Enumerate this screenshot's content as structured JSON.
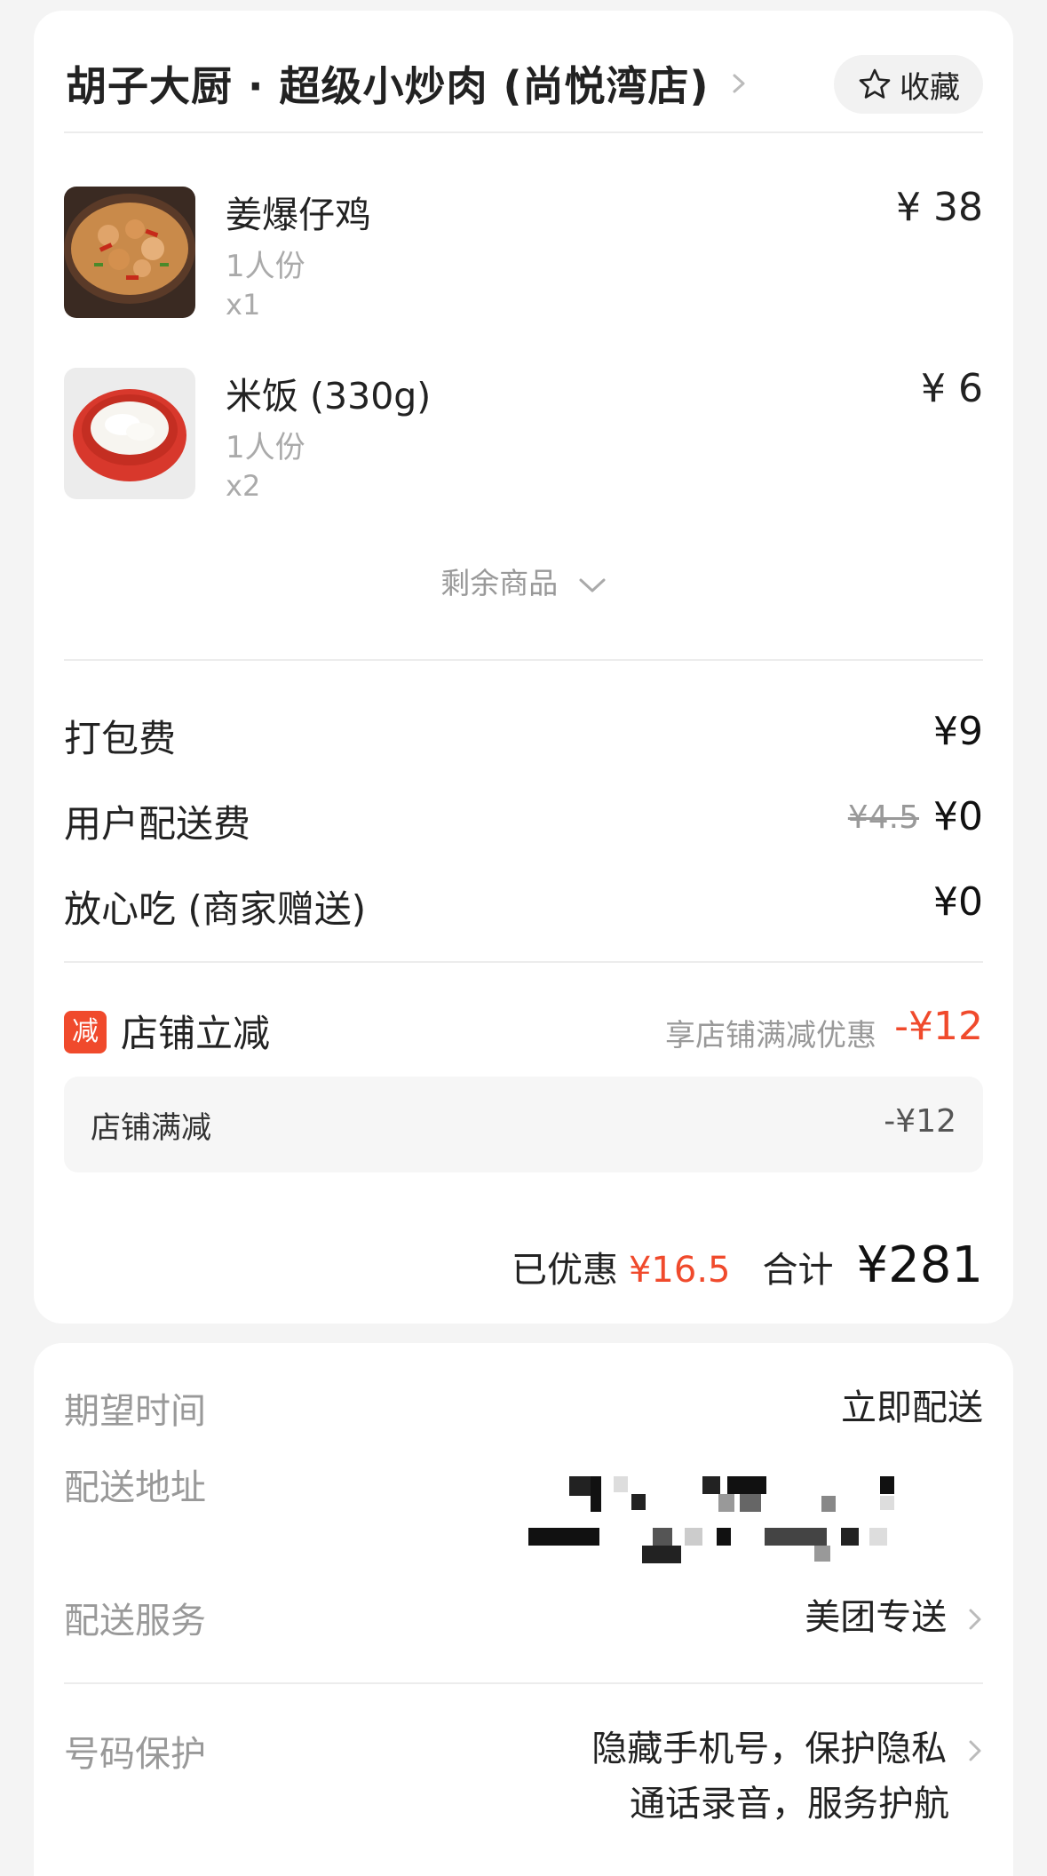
{
  "shop": {
    "name": "胡子大厨 · 超级小炒肉 (尚悦湾店)",
    "favorite_label": "收藏"
  },
  "items": [
    {
      "name": "姜爆仔鸡",
      "spec": "1人份",
      "qty": "x1",
      "price": "¥ 38",
      "image": "food-dish-image"
    },
    {
      "name": "米饭 (330g)",
      "spec": "1人份",
      "qty": "x2",
      "price": "¥ 6",
      "image": "rice-bowl-image"
    }
  ],
  "more_label": "剩余商品",
  "fees": [
    {
      "label": "打包费",
      "value": "¥9"
    },
    {
      "label": "用户配送费",
      "old_value": "¥4.5",
      "value": "¥0"
    },
    {
      "label": "放心吃 (商家赠送)",
      "value": "¥0"
    }
  ],
  "discount": {
    "badge": "减",
    "label": "店铺立减",
    "desc": "享店铺满减优惠",
    "value": "-¥12",
    "sub_label": "店铺满减",
    "sub_value": "-¥12"
  },
  "summary": {
    "saved_label": "已优惠",
    "saved_value": "¥16.5",
    "total_label": "合计",
    "total_value": "¥281"
  },
  "delivery": {
    "time_label": "期望时间",
    "time_value": "立即配送",
    "address_label": "配送地址",
    "service_label": "配送服务",
    "service_value": "美团专送",
    "privacy_label": "号码保护",
    "privacy_line1": "隐藏手机号，保护隐私",
    "privacy_line2": "通话录音，服务护航"
  },
  "colors": {
    "accent_red": "#f04a2c",
    "muted": "#999999",
    "background": "#f4f4f4"
  }
}
